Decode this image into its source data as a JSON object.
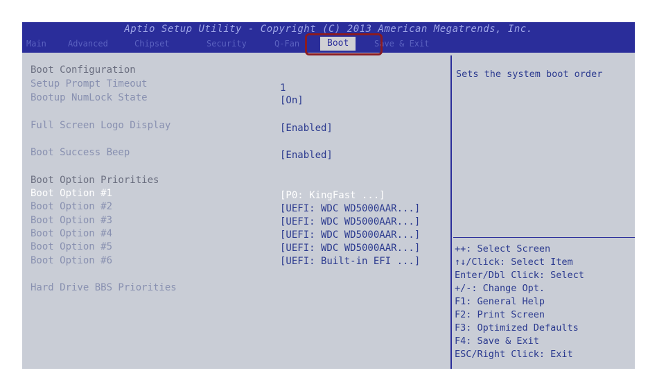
{
  "title": "Aptio Setup Utility - Copyright (C) 2013 American Megatrends, Inc.",
  "tabs": [
    {
      "label": "Main"
    },
    {
      "label": "Advanced"
    },
    {
      "label": "Chipset"
    },
    {
      "label": "Security"
    },
    {
      "label": "Q-Fan"
    },
    {
      "label": "Boot"
    },
    {
      "label": "Save & Exit"
    }
  ],
  "active_tab": "Boot",
  "main": {
    "boot_config": "Boot Configuration",
    "setup_prompt_timeout": {
      "label": "Setup Prompt Timeout",
      "value": "1"
    },
    "bootup_numlock": {
      "label": "Bootup NumLock State",
      "value": "[On]"
    },
    "full_screen_logo": {
      "label": "Full Screen Logo Display",
      "value": "[Enabled]"
    },
    "boot_success_beep": {
      "label": "Boot Success Beep",
      "value": "[Enabled]"
    },
    "boot_option_priorities": "Boot Option Priorities",
    "boot_options": [
      {
        "label": "Boot Option #1",
        "value": "[P0: KingFast      ...]"
      },
      {
        "label": "Boot Option #2",
        "value": "[UEFI: WDC WD5000AAR...]"
      },
      {
        "label": "Boot Option #3",
        "value": "[UEFI: WDC WD5000AAR...]"
      },
      {
        "label": "Boot Option #4",
        "value": "[UEFI: WDC WD5000AAR...]"
      },
      {
        "label": "Boot Option #5",
        "value": "[UEFI: WDC WD5000AAR...]"
      },
      {
        "label": "Boot Option #6",
        "value": "[UEFI: Built-in EFI ...]"
      }
    ],
    "hard_drive_bbs": "Hard Drive BBS Priorities"
  },
  "help": {
    "description": "Sets the system boot order",
    "nav": [
      "++: Select Screen",
      "↑↓/Click: Select Item",
      "Enter/Dbl Click: Select",
      "+/-: Change Opt.",
      "F1: General Help",
      "F2: Print Screen",
      "F3: Optimized Defaults",
      "F4: Save & Exit",
      "ESC/Right Click: Exit"
    ]
  },
  "colors": {
    "title_bar": "#2a2d9a",
    "background": "#c9cdd6",
    "highlight_border": "#8b1b21",
    "value_text": "#2b3a8f"
  }
}
